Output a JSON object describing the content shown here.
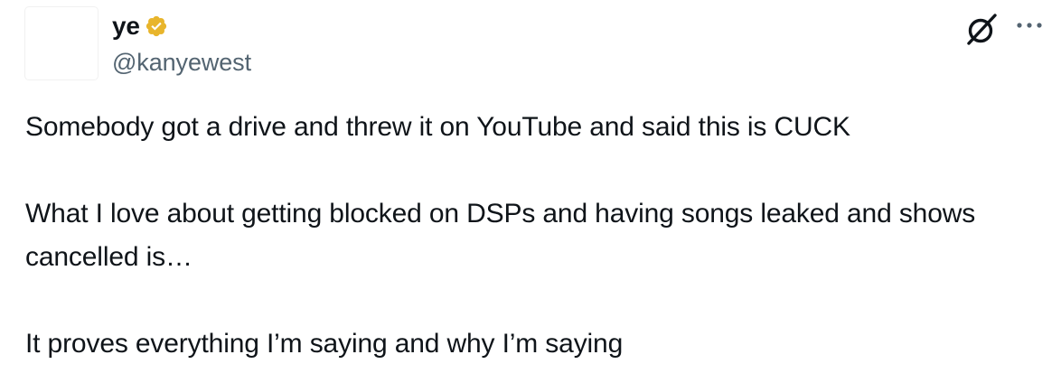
{
  "author": {
    "display_name": "ye",
    "handle": "@kanyewest",
    "verified_badge_color": "#e8b52c"
  },
  "icons": {
    "verified": "verified-badge-icon",
    "grok": "grok-icon",
    "more": "more-options-icon"
  },
  "tweet": {
    "paragraphs": [
      "Somebody got a drive and threw it on YouTube and said this is CUCK",
      "What I love about getting blocked on DSPs and having songs leaked and shows cancelled is…",
      "It proves everything I’m saying and why I’m saying"
    ]
  }
}
